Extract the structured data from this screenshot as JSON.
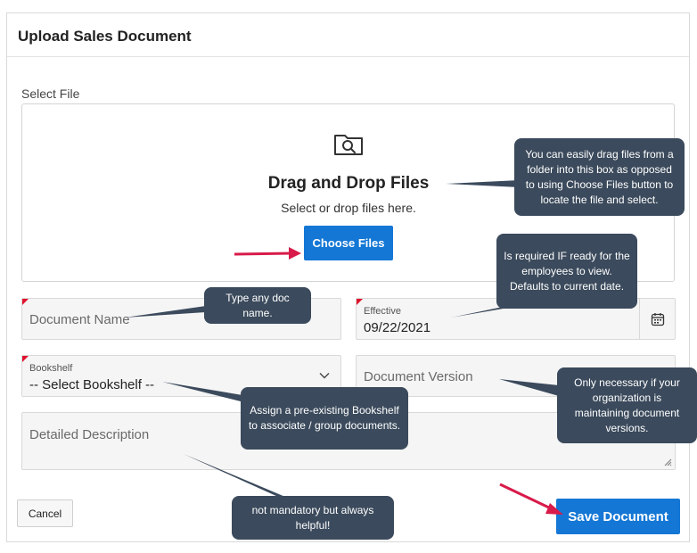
{
  "dialog": {
    "title": "Upload Sales Document"
  },
  "file": {
    "label": "Select File",
    "icon": "folder-search-icon",
    "drop_title": "Drag and Drop Files",
    "drop_sub": "Select or drop files here.",
    "choose_label": "Choose Files"
  },
  "fields": {
    "document_name": {
      "placeholder": "Document Name",
      "required": true
    },
    "effective": {
      "label": "Effective",
      "value": "09/22/2021",
      "required": true,
      "icon": "calendar-icon"
    },
    "bookshelf": {
      "label": "Bookshelf",
      "value": "-- Select Bookshelf --",
      "required": true,
      "icon": "chevron-down-icon"
    },
    "document_version": {
      "placeholder": "Document Version"
    },
    "detailed_description": {
      "placeholder": "Detailed Description"
    }
  },
  "actions": {
    "cancel_label": "Cancel",
    "save_label": "Save Document"
  },
  "callouts": {
    "drag": "You can easily drag files from a folder into this box as opposed to using Choose Files button to locate the file and select.",
    "effective": "Is required IF ready for the employees to view. Defaults to current date.",
    "doc_name": "Type any doc name.",
    "bookshelf": "Assign a pre-existing Bookshelf to associate / group documents.",
    "version": "Only necessary if your organization is maintaining document versions.",
    "description": "not mandatory but always helpful!"
  },
  "colors": {
    "primary": "#1477d5",
    "callout": "#3b4a5c",
    "annotation_arrow": "#d81b4a",
    "required_marker": "#e0122e"
  }
}
